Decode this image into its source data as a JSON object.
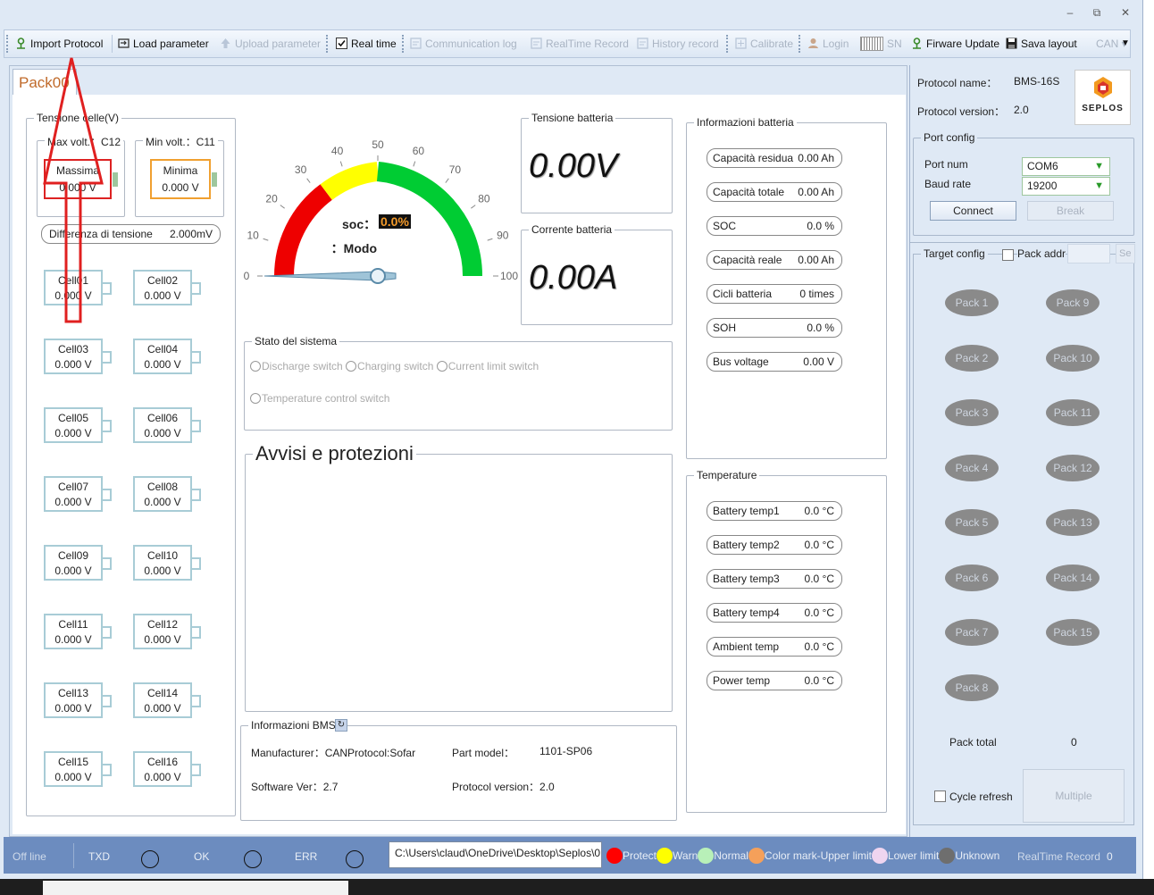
{
  "window": {
    "min": "–",
    "restore": "⧉",
    "close": "✕"
  },
  "toolbar": {
    "import_protocol": "Import Protocol",
    "load_parameter": "Load parameter",
    "upload_parameter": "Upload parameter",
    "real_time": "Real time",
    "communication_log": "Communication log",
    "realtime_record": "RealTime Record",
    "history_record": "History record",
    "calibrate": "Calibrate",
    "login": "Login",
    "sn": "SN",
    "firmware_update": "Firware Update",
    "save_layout": "Sava layout",
    "can": "CAN"
  },
  "tab": {
    "label": "Pack00"
  },
  "cells": {
    "group_label": "Tensione celle(V)",
    "max_label": "Max volt.：C12",
    "min_label": "Min volt.：C11",
    "max_title": "Massima",
    "max_value": "0.000 V",
    "min_title": "Minima",
    "min_value": "0.000 V",
    "diff_label": "Differenza di tensione",
    "diff_value": "2.000mV",
    "items": [
      {
        "name": "Cell01",
        "value": "0.000 V"
      },
      {
        "name": "Cell02",
        "value": "0.000 V"
      },
      {
        "name": "Cell03",
        "value": "0.000 V"
      },
      {
        "name": "Cell04",
        "value": "0.000 V"
      },
      {
        "name": "Cell05",
        "value": "0.000 V"
      },
      {
        "name": "Cell06",
        "value": "0.000 V"
      },
      {
        "name": "Cell07",
        "value": "0.000 V"
      },
      {
        "name": "Cell08",
        "value": "0.000 V"
      },
      {
        "name": "Cell09",
        "value": "0.000 V"
      },
      {
        "name": "Cell10",
        "value": "0.000 V"
      },
      {
        "name": "Cell11",
        "value": "0.000 V"
      },
      {
        "name": "Cell12",
        "value": "0.000 V"
      },
      {
        "name": "Cell13",
        "value": "0.000 V"
      },
      {
        "name": "Cell14",
        "value": "0.000 V"
      },
      {
        "name": "Cell15",
        "value": "0.000 V"
      },
      {
        "name": "Cell16",
        "value": "0.000 V"
      }
    ]
  },
  "gauge": {
    "ticks": [
      "0",
      "10",
      "20",
      "30",
      "40",
      "50",
      "60",
      "70",
      "80",
      "90",
      "100"
    ],
    "soc_label": "soc：",
    "soc_value": "0.0%",
    "mode_label": "Modo：",
    "needle_value": 0
  },
  "battery_voltage": {
    "label": "Tensione batteria",
    "value": "0.00V"
  },
  "battery_current": {
    "label": "Corrente batteria",
    "value": "0.00A"
  },
  "system_state": {
    "label": "Stato del sistema",
    "discharge": "Discharge switch",
    "charging": "Charging switch",
    "current_limit": "Current limit switch",
    "temperature_control": "Temperature control switch"
  },
  "warnings": {
    "label": "Avvisi e protezioni"
  },
  "bms_info": {
    "label": "Informazioni BMS",
    "manufacturer": "Manufacturer：CANProtocol:Sofar",
    "part_model_label": "Part model：",
    "part_model_value": "1101-SP06",
    "software_ver": "Software Ver：2.7",
    "protocol_version": "Protocol version：2.0"
  },
  "battery_info": {
    "label": "Informazioni batteria",
    "items": [
      {
        "name": "Capacità residua",
        "value": "0.00 Ah"
      },
      {
        "name": "Capacità totale",
        "value": "0.00 Ah"
      },
      {
        "name": "SOC",
        "value": "0.0 %"
      },
      {
        "name": "Capacità reale",
        "value": "0.00 Ah"
      },
      {
        "name": "Cicli batteria",
        "value": "0 times"
      },
      {
        "name": "SOH",
        "value": "0.0 %"
      },
      {
        "name": "Bus voltage",
        "value": "0.00 V"
      }
    ]
  },
  "temperature": {
    "label": "Temperature",
    "items": [
      {
        "name": "Battery temp1",
        "value": "0.0 °C"
      },
      {
        "name": "Battery temp2",
        "value": "0.0 °C"
      },
      {
        "name": "Battery temp3",
        "value": "0.0 °C"
      },
      {
        "name": "Battery temp4",
        "value": "0.0 °C"
      },
      {
        "name": "Ambient temp",
        "value": "0.0 °C"
      },
      {
        "name": "Power temp",
        "value": "0.0 °C"
      }
    ]
  },
  "protocol": {
    "name_label": "Protocol name：",
    "name_value": "BMS-16S",
    "version_label": "Protocol version：",
    "version_value": "2.0",
    "logo_text": "SEPLOS"
  },
  "port": {
    "label": "Port config",
    "port_num_label": "Port num",
    "port_num_value": "COM6",
    "baud_label": "Baud rate",
    "baud_value": "19200",
    "connect": "Connect",
    "break": "Break"
  },
  "target": {
    "label": "Target config",
    "pack_addr": "Pack addr",
    "packs": [
      "Pack 1",
      "Pack 9",
      "Pack 2",
      "Pack 10",
      "Pack 3",
      "Pack 11",
      "Pack 4",
      "Pack 12",
      "Pack 5",
      "Pack 13",
      "Pack 6",
      "Pack 14",
      "Pack 7",
      "Pack 15",
      "Pack 8"
    ],
    "pack_total_label": "Pack total",
    "pack_total_value": "0",
    "cycle_refresh": "Cycle refresh",
    "multiple": "Multiple"
  },
  "status": {
    "offline": "Off line",
    "txd": "TXD",
    "ok": "OK",
    "err": "ERR",
    "path": "C:\\Users\\claud\\OneDrive\\Desktop\\Seplos\\0",
    "legend": [
      {
        "label": "Protect",
        "color": "#ff0000"
      },
      {
        "label": "Warn",
        "color": "#ffff00"
      },
      {
        "label": "Normal",
        "color": "#b8f0b8"
      },
      {
        "label": "Color mark-Upper limit",
        "color": "#f5a05a"
      },
      {
        "label": "Lower limit",
        "color": "#efd5f0"
      },
      {
        "label": "Unknown",
        "color": "#6e6e6e"
      }
    ],
    "realtime_record": "RealTime Record",
    "record_count": "0"
  },
  "colors": {
    "protect": "#ff0000",
    "warn": "#ffff00",
    "normal": "#00cc33",
    "max_border": "#d22",
    "min_border": "#f0a030"
  }
}
